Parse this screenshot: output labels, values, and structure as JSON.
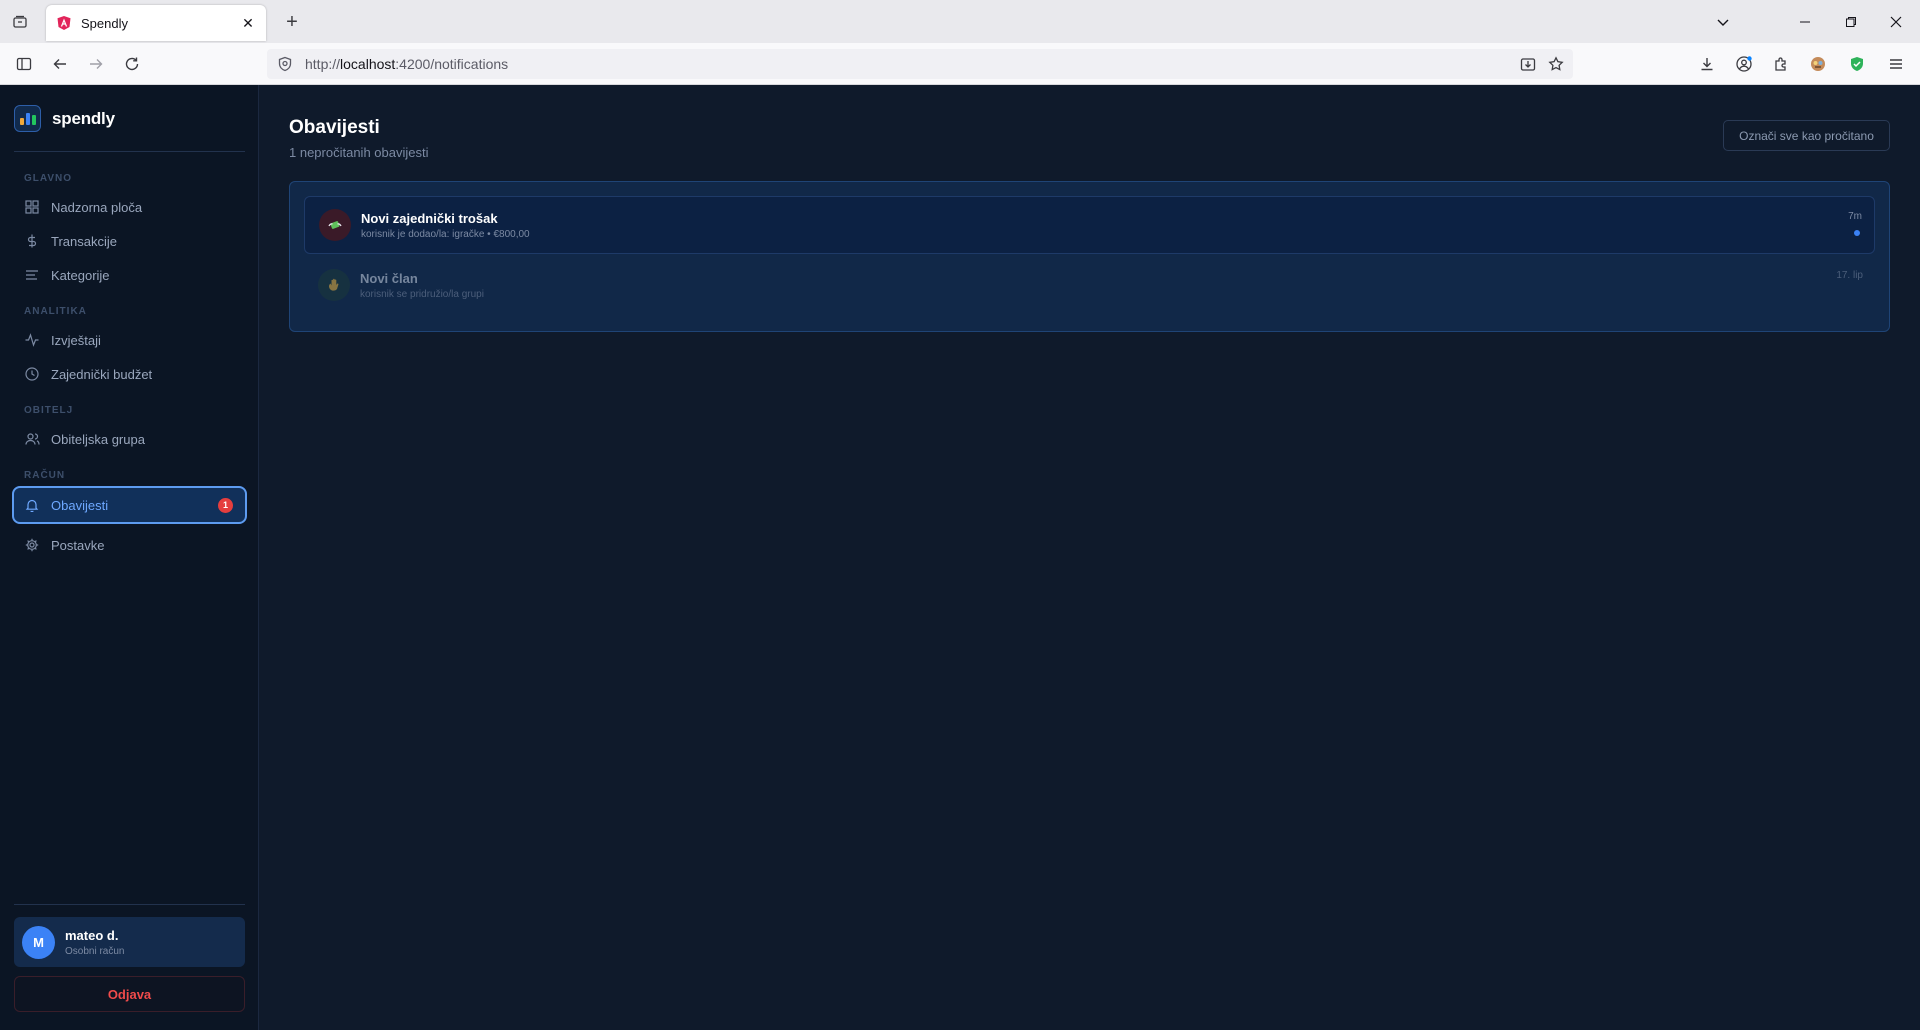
{
  "browser": {
    "tab_title": "Spendly",
    "url_prefix": "http://",
    "url_host": "localhost",
    "url_path": ":4200/notifications"
  },
  "brand": {
    "name": "spendly"
  },
  "sidebar": {
    "sections": {
      "main": "GLAVNO",
      "analytics": "ANALITIKA",
      "family": "OBITELJ",
      "account": "RAČUN"
    },
    "items": {
      "dashboard": "Nadzorna ploča",
      "transactions": "Transakcije",
      "categories": "Kategorije",
      "reports": "Izvještaji",
      "shared_budget": "Zajednički budžet",
      "family_group": "Obiteljska grupa",
      "notifications": "Obavijesti",
      "notifications_badge": "1",
      "settings": "Postavke"
    },
    "user": {
      "initial": "M",
      "name": "mateo d.",
      "account_type": "Osobni račun"
    },
    "logout": "Odjava"
  },
  "main": {
    "title": "Obavijesti",
    "subtitle": "1 nepročitanih obavijesti",
    "mark_all": "Označi sve kao pročitano",
    "notifications": [
      {
        "title": "Novi zajednički trošak",
        "body": "korisnik je dodao/la: igračke • €800,00",
        "time": "7m",
        "icon": "money-wings-icon"
      },
      {
        "title": "Novi član",
        "body": "korisnik se pridružio/la grupi",
        "time": "17. lip",
        "icon": "waving-hand-icon"
      }
    ]
  },
  "colors": {
    "accent": "#3b82f6",
    "active_text": "#6ea8ff",
    "danger": "#f04b4b",
    "badge": "#e53e3e"
  }
}
